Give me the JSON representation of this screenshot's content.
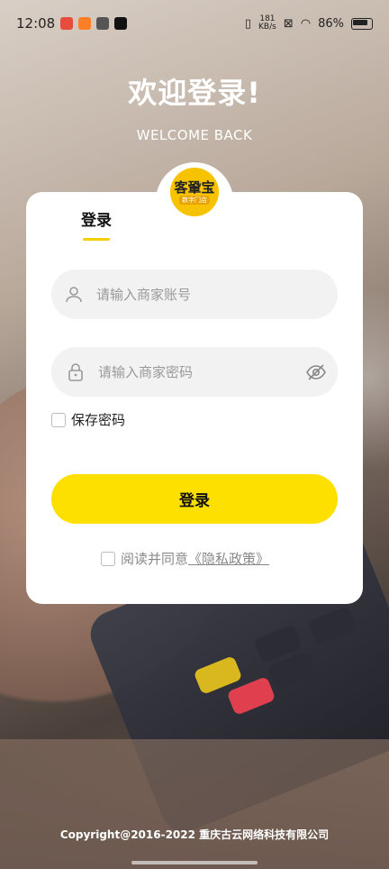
{
  "status_bar": {
    "time": "12:08",
    "net_speed_value": "181",
    "net_speed_unit": "KB/s",
    "battery": "86%"
  },
  "header": {
    "title": "欢迎登录!",
    "subtitle": "WELCOME BACK"
  },
  "logo": {
    "main": "客䡗宝",
    "sub": "数字门店"
  },
  "tabs": {
    "login": "登录"
  },
  "form": {
    "account_placeholder": "请输入商家账号",
    "password_placeholder": "请输入商家密码",
    "save_password_label": "保存密码",
    "submit_label": "登录"
  },
  "agreement": {
    "prefix": "阅读并同意",
    "link": "《隐私政策》"
  },
  "footer": {
    "copyright": "Copyright@2016-2022 重庆古云网络科技有限公司"
  },
  "colors": {
    "accent": "#fde000",
    "logo": "#f7c300"
  }
}
